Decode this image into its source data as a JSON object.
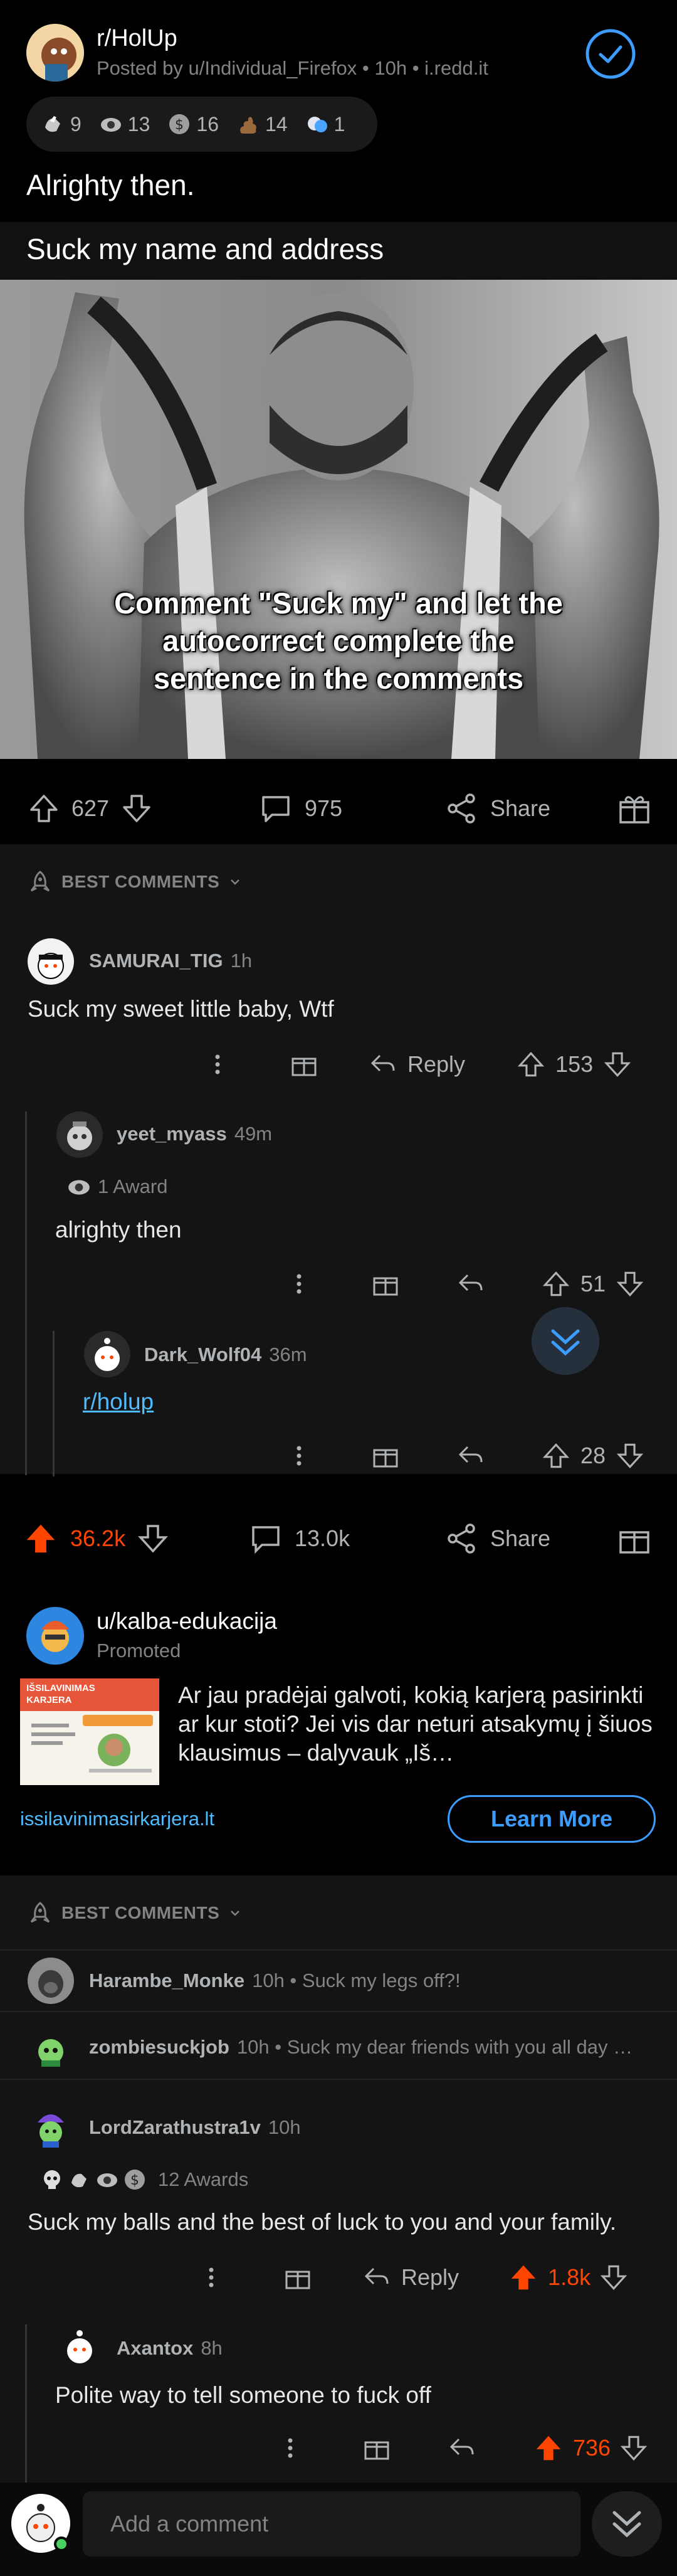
{
  "post": {
    "subreddit": "r/HolUp",
    "meta": "Posted by u/Individual_Firefox • 10h • i.redd.it",
    "awards": [
      {
        "icon": "award-hands-icon",
        "count": "9"
      },
      {
        "icon": "award-eye-icon",
        "count": "13"
      },
      {
        "icon": "award-dollar-icon",
        "count": "16"
      },
      {
        "icon": "award-poop-icon",
        "count": "14"
      },
      {
        "icon": "award-hug-icon",
        "count": "1"
      }
    ],
    "title": "Alrighty then.",
    "meme_caption": "Suck my name and address",
    "image_text": "Comment \"Suck my\" and let the autocorrect complete the sentence in the comments",
    "upvotes": "627",
    "comments": "975",
    "share_label": "Share"
  },
  "best_comments_label": "BEST COMMENTS",
  "comments_top": [
    {
      "user": "SAMURAI_TIG",
      "time": "1h",
      "body": "Suck my sweet little baby, Wtf",
      "reply_label": "Reply",
      "score": "153"
    },
    {
      "user": "yeet_myass",
      "time": "49m",
      "award_text": "1 Award",
      "body": "alrighty then",
      "score": "51"
    },
    {
      "user": "Dark_Wolf04",
      "time": "36m",
      "body": "r/holup",
      "score": "28"
    }
  ],
  "post2": {
    "upvotes": "36.2k",
    "comments": "13.0k",
    "share_label": "Share"
  },
  "ad": {
    "user": "u/kalba-edukacija",
    "promoted": "Promoted",
    "thumb_title": "IŠSILAVINIMAS KARJERA",
    "text": "Ar jau pradėjai galvoti, kokią karjerą pasirinkti ar kur stoti? Jei vis dar neturi atsakymų į šiuos klausimus – dalyvauk „Iš…",
    "domain": "issilavinimasirkarjera.lt",
    "cta": "Learn More"
  },
  "comments_bottom": [
    {
      "user": "Harambe_Monke",
      "time": "10h • Suck my legs off?!"
    },
    {
      "user": "zombiesuckjob",
      "time": "10h • Suck my dear friends with you all day …"
    },
    {
      "user": "LordZarathustra1v",
      "time": "10h",
      "award_text": "12 Awards",
      "body": "Suck my balls and the best of luck to you and your family.",
      "reply_label": "Reply",
      "score": "1.8k"
    },
    {
      "user": "Axantox",
      "time": "8h",
      "body": "Polite way to tell someone to fuck off",
      "score": "736"
    }
  ],
  "composer": {
    "placeholder": "Add a comment"
  },
  "colors": {
    "upvote_active": "#ff4500",
    "link": "#4fbcff",
    "accent": "#3c9dff"
  }
}
